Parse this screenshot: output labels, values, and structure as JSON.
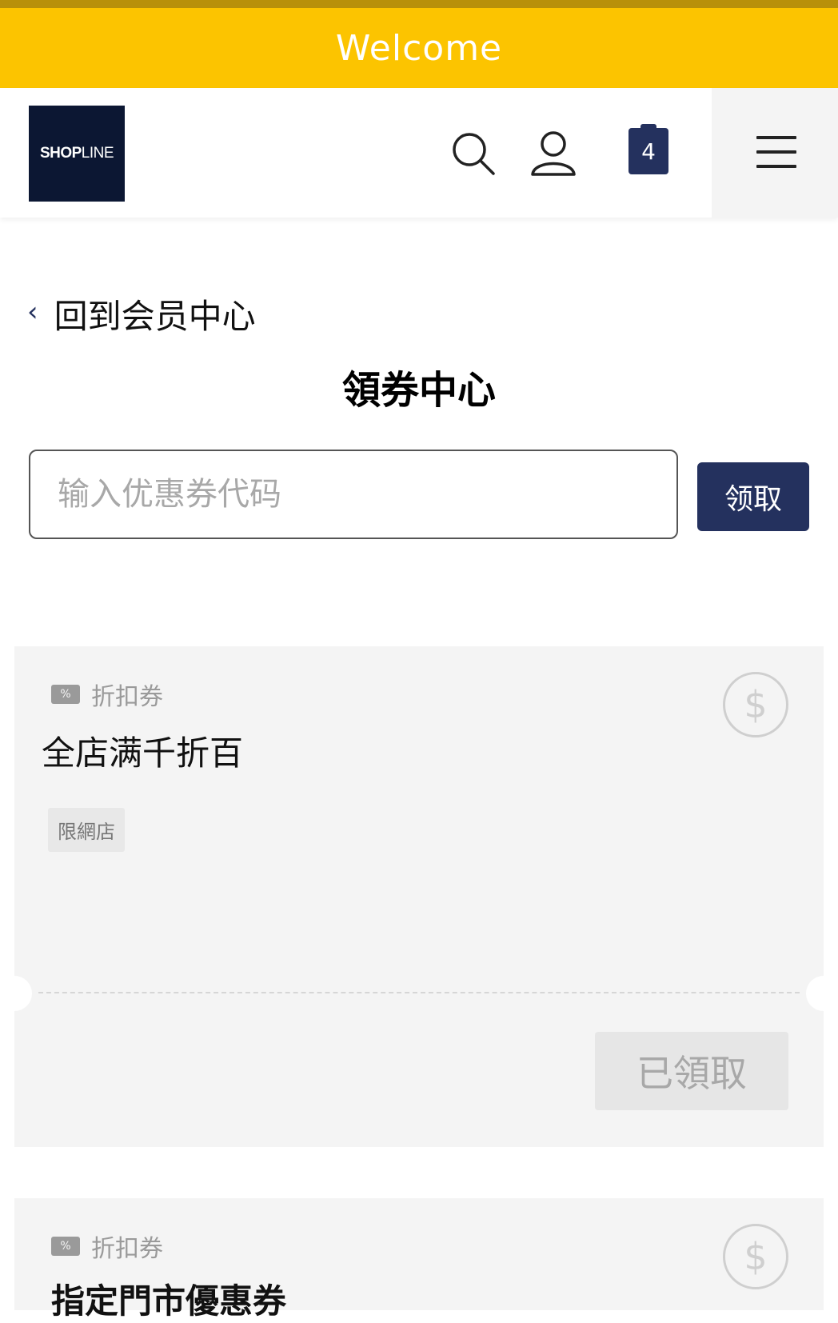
{
  "banner": {
    "text": "Welcome",
    "color": "#fcc400"
  },
  "header": {
    "logo_bold": "SHOP",
    "logo_light": "LINE",
    "icons": [
      "search-icon",
      "user-icon",
      "cart-icon",
      "menu-icon"
    ],
    "cart_count": "4",
    "accent": "#24315e"
  },
  "nav": {
    "back_label": "回到会员中心"
  },
  "page": {
    "title": "領券中心"
  },
  "code_entry": {
    "placeholder": "输入优惠券代码",
    "value": "",
    "button_label": "领取"
  },
  "coupons": [
    {
      "type_label": "折扣券",
      "name": "全店满千折百",
      "badge": "限網店",
      "action_label": "已領取",
      "icon": "dollar-icon"
    },
    {
      "type_label": "折扣券",
      "name": "指定門市優惠券",
      "icon": "dollar-icon"
    }
  ]
}
